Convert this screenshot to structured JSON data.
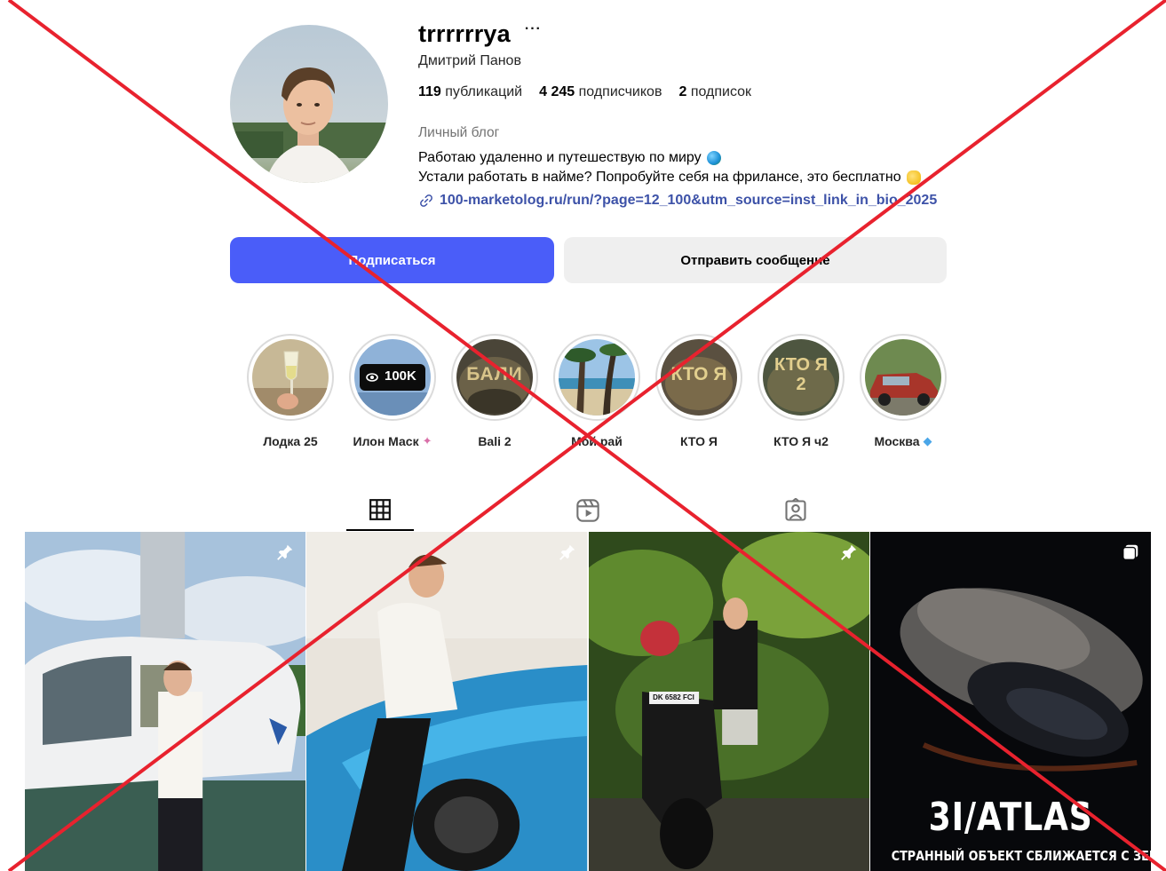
{
  "profile": {
    "username": "trrrrrrya",
    "more_label": "···",
    "full_name": "Дмитрий Панов",
    "stats": [
      {
        "count": "119",
        "label": "публикаций"
      },
      {
        "count": "4 245",
        "label": "подписчиков"
      },
      {
        "count": "2",
        "label": "подписок"
      }
    ],
    "category": "Личный блог",
    "bio_lines": [
      "Работаю удаленно и путешествую по миру",
      "Устали работать в найме? Попробуйте себя на фрилансе, это бесплатно"
    ],
    "link": "100-marketolog.ru/run/?page=12_100&utm_source=inst_link_in_bio_2025"
  },
  "actions": {
    "follow": "Подписаться",
    "message": "Отправить сообщение"
  },
  "highlights": [
    {
      "label": "Лодка 25",
      "icon": "wine-glass"
    },
    {
      "label": "Илон Маск",
      "icon": "views-100k",
      "badge_text": "100K"
    },
    {
      "label": "Bali 2",
      "icon": "text-cover",
      "cover_text": "БАЛИ"
    },
    {
      "label": "Мой рай",
      "icon": "beach"
    },
    {
      "label": "КТО Я",
      "icon": "text-cover",
      "cover_text": "КТО Я"
    },
    {
      "label": "КТО Я ч2",
      "icon": "text-cover",
      "cover_text": "КТО Я 2"
    },
    {
      "label": "Москва",
      "icon": "red-car"
    }
  ],
  "tabs": [
    {
      "name": "posts",
      "icon": "grid-icon",
      "active": true
    },
    {
      "name": "reels",
      "icon": "reels-icon",
      "active": false
    },
    {
      "name": "tagged",
      "icon": "tagged-icon",
      "active": false
    }
  ],
  "posts": [
    {
      "scene": "man-by-helicopter",
      "pinned": true
    },
    {
      "scene": "man-on-blue-car",
      "pinned": true
    },
    {
      "scene": "man-on-scooter-jungle",
      "pinned": true,
      "plate": "DK 6582 FCI"
    },
    {
      "scene": "asteroid-ship",
      "carousel": true,
      "title": "3I/ATLAS",
      "subtitle": "СТРАННЫЙ ОБЪЕКТ СБЛИЖАЕТСЯ С ЗЕМЛЕЙ"
    }
  ],
  "colors": {
    "follow_button": "#4a5df9",
    "message_button": "#efefef",
    "link": "#3d52a8",
    "cross": "#e8222e"
  }
}
